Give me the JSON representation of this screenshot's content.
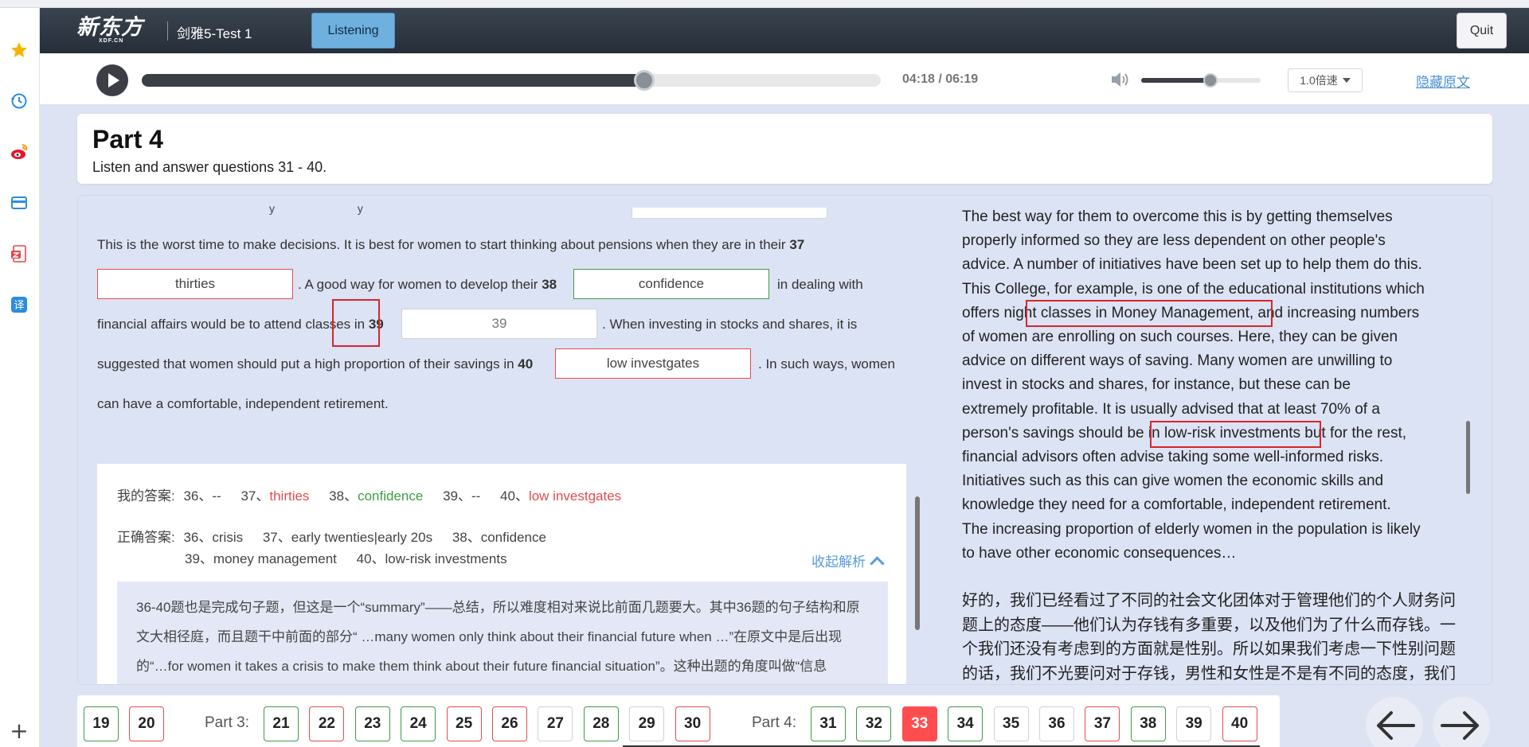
{
  "header": {
    "logo_text": "新东方",
    "logo_sub": "XDF.CN",
    "test_title": "剑雅5-Test 1",
    "mode_button": "Listening",
    "quit_button": "Quit"
  },
  "player": {
    "time": "04:18 / 06:19",
    "progress": 0.68,
    "volume": 0.58,
    "speed": "1.0倍速",
    "hide_transcript": "隐藏原文"
  },
  "part": {
    "title": "Part 4",
    "instruction": "Listen and answer questions 31 - 40."
  },
  "questions": {
    "line1": "This is the worst time to make decisions. It is best for women to start thinking about pensions when they are in their",
    "line1_num": "37",
    "ans37": "thirties",
    "line2a": ". A good way for women to develop their",
    "line2_num": "38",
    "ans38": "confidence",
    "line2b": "in dealing with",
    "line3a": "financial affairs would be to attend classes in",
    "line3_num": "39",
    "ans39": "39",
    "line3b": ". When investing in stocks and shares, it is",
    "line4a": "suggested that women should put a high proportion of their savings in",
    "line4_num": "40",
    "ans40": "low investgates",
    "line4b": ". In such ways, women",
    "line5": "can have a comfortable, independent retirement."
  },
  "analysis": {
    "my_label": "我的答案:",
    "my_answers": [
      {
        "text": "36、--",
        "status": "none"
      },
      {
        "text": "37、",
        "value": "thirties",
        "status": "wrong"
      },
      {
        "text": "38、",
        "value": "confidence",
        "status": "right"
      },
      {
        "text": "39、--",
        "status": "none"
      },
      {
        "text": "40、",
        "value": "low investgates",
        "status": "wrong"
      }
    ],
    "correct_label": "正确答案:",
    "correct_line1": [
      "36、crisis",
      "37、early twenties|early 20s",
      "38、confidence"
    ],
    "correct_line2": [
      "39、money management",
      "40、low-risk investments"
    ],
    "collapse": "收起解析",
    "explanation": "36-40题也是完成句子题，但这是一个“summary”——总结，所以难度相对来说比前面几题要大。其中36题的句子结构和原文大相径庭，而且题干中前面的部分“ …many women only think about their financial future when …”在原文中是后出现的“…for women it takes a crisis to make them think about their future financial situation”。这种出题的角度叫做“信息"
  },
  "transcript": {
    "en_lines": [
      "The best way for them to overcome this is by getting themselves",
      "properly informed so they are less dependent on other people's",
      "advice. A number of initiatives have been set up to help them do this.",
      "This College, for example, is one of the educational institutions which",
      "offers night classes in Money Management, and increasing numbers",
      "of women are enrolling on such courses. Here, they can be given",
      "advice on different ways of saving. Many women are unwilling to",
      "invest in stocks and shares, for instance, but these can be",
      "extremely profitable. It is usually advised that at least 70% of a",
      "person's savings should be in low-risk investments but for the rest,",
      "financial advisors often advise taking some well-informed risks.",
      "Initiatives such as this can give women the economic skills and",
      "knowledge they need for a comfortable, independent retirement.",
      "The increasing proportion of elderly women in the population is likely",
      "to have other economic consequences…"
    ],
    "cn_lines": [
      "好的，我们已经看过了不同的社会文化团体对于管理他们的个人财务问",
      "题上的态度——他们认为存钱有多重要，以及他们为了什么而存钱。一",
      "个我们还没有考虑到的方面就是性别。所以如果我们考虑一下性别问题",
      "的话，我们不光要问对于存钱，男性和女性是不是有不同的态度，我们"
    ]
  },
  "nav": {
    "items_prev": [
      {
        "num": "19",
        "status": "green"
      },
      {
        "num": "20",
        "status": "red"
      }
    ],
    "part3_label": "Part 3:",
    "part3": [
      {
        "num": "21",
        "status": "green"
      },
      {
        "num": "22",
        "status": "red"
      },
      {
        "num": "23",
        "status": "green"
      },
      {
        "num": "24",
        "status": "green"
      },
      {
        "num": "25",
        "status": "red"
      },
      {
        "num": "26",
        "status": "red"
      },
      {
        "num": "27",
        "status": "gray"
      },
      {
        "num": "28",
        "status": "green"
      },
      {
        "num": "29",
        "status": "gray"
      },
      {
        "num": "30",
        "status": "red"
      }
    ],
    "part4_label": "Part 4:",
    "part4": [
      {
        "num": "31",
        "status": "green"
      },
      {
        "num": "32",
        "status": "green"
      },
      {
        "num": "33",
        "status": "active"
      },
      {
        "num": "34",
        "status": "green"
      },
      {
        "num": "35",
        "status": "gray"
      },
      {
        "num": "36",
        "status": "gray"
      },
      {
        "num": "37",
        "status": "red"
      },
      {
        "num": "38",
        "status": "green"
      },
      {
        "num": "39",
        "status": "gray"
      },
      {
        "num": "40",
        "status": "red"
      }
    ]
  },
  "colors": {
    "accent_blue": "#5a9be0",
    "wrong": "#e74c4c",
    "right": "#3f9b46",
    "active": "#ff4d4f",
    "header_bg": "#2e3641"
  }
}
